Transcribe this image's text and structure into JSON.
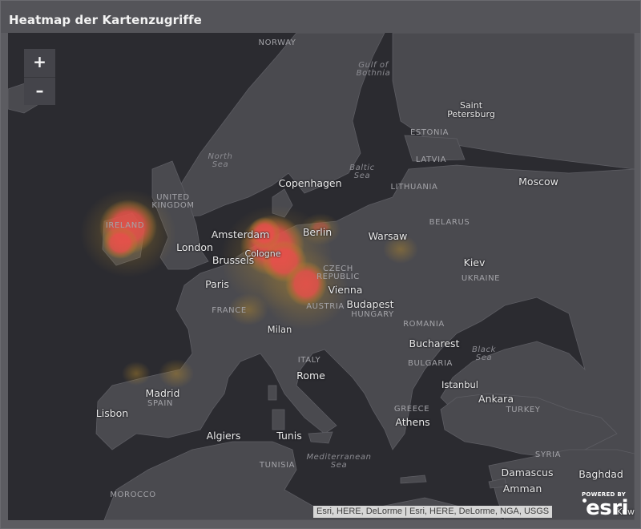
{
  "widget": {
    "title": "Heatmap der Kartenzugriffe"
  },
  "map": {
    "zoom": {
      "in_label": "+",
      "out_label": "–"
    },
    "attribution": "Esri, HERE, DeLorme | Esri, HERE, DeLorme, NGA, USGS",
    "logo": {
      "powered_by": "POWERED BY",
      "word": "esri"
    },
    "cities": {
      "saint_petersburg": "Saint\nPetersburg",
      "copenhagen": "Copenhagen",
      "moscow": "Moscow",
      "amsterdam": "Amsterdam",
      "berlin": "Berlin",
      "warsaw": "Warsaw",
      "london": "London",
      "brussels": "Brussels",
      "cologne": "Cologne",
      "kiev": "Kiev",
      "paris": "Paris",
      "vienna": "Vienna",
      "budapest": "Budapest",
      "milan": "Milan",
      "bucharest": "Bucharest",
      "rome": "Rome",
      "istanbul": "Istanbul",
      "madrid": "Madrid",
      "ankara": "Ankara",
      "lisbon": "Lisbon",
      "athens": "Athens",
      "algiers": "Algiers",
      "tunis": "Tunis",
      "damascus": "Damascus",
      "baghdad": "Baghdad",
      "amman": "Amman",
      "kuwait": "Kuwa"
    },
    "countries": {
      "norway": "NORWAY",
      "estonia": "ESTONIA",
      "latvia": "LATVIA",
      "lithuania": "LITHUANIA",
      "united_kingdom": "UNITED\nKINGDOM",
      "ireland": "IRELAND",
      "belarus": "BELARUS",
      "czech_republic": "CZECH\nREPUBLIC",
      "ukraine": "UKRAINE",
      "france": "FRANCE",
      "austria": "AUSTRIA",
      "hungary": "HUNGARY",
      "romania": "ROMANIA",
      "italy": "ITALY",
      "bulgaria": "BULGARIA",
      "spain": "SPAIN",
      "greece": "GREECE",
      "turkey": "TURKEY",
      "syria": "SYRIA",
      "tunisia": "TUNISIA",
      "morocco": "MOROCCO"
    },
    "seas": {
      "gulf_of_bothnia": "Gulf of\nBothnia",
      "north_sea": "North\nSea",
      "baltic_sea": "Baltic\nSea",
      "black_sea": "Black\nSea",
      "mediterranean_sea": "Mediterranean\nSea"
    },
    "heatmap": {
      "hotspot_color": "#e4514a",
      "glow_color": "#b88a2a",
      "hotspots": [
        {
          "area": "Ireland",
          "level": "high"
        },
        {
          "area": "Amsterdam / Cologne",
          "level": "high"
        },
        {
          "area": "Austria / Bavaria",
          "level": "high"
        },
        {
          "area": "Berlin",
          "level": "low"
        },
        {
          "area": "Madrid",
          "level": "low"
        }
      ]
    },
    "colors": {
      "water": "#2b2b30",
      "land": "#4a4a4f",
      "border": "#5d5d63"
    }
  }
}
